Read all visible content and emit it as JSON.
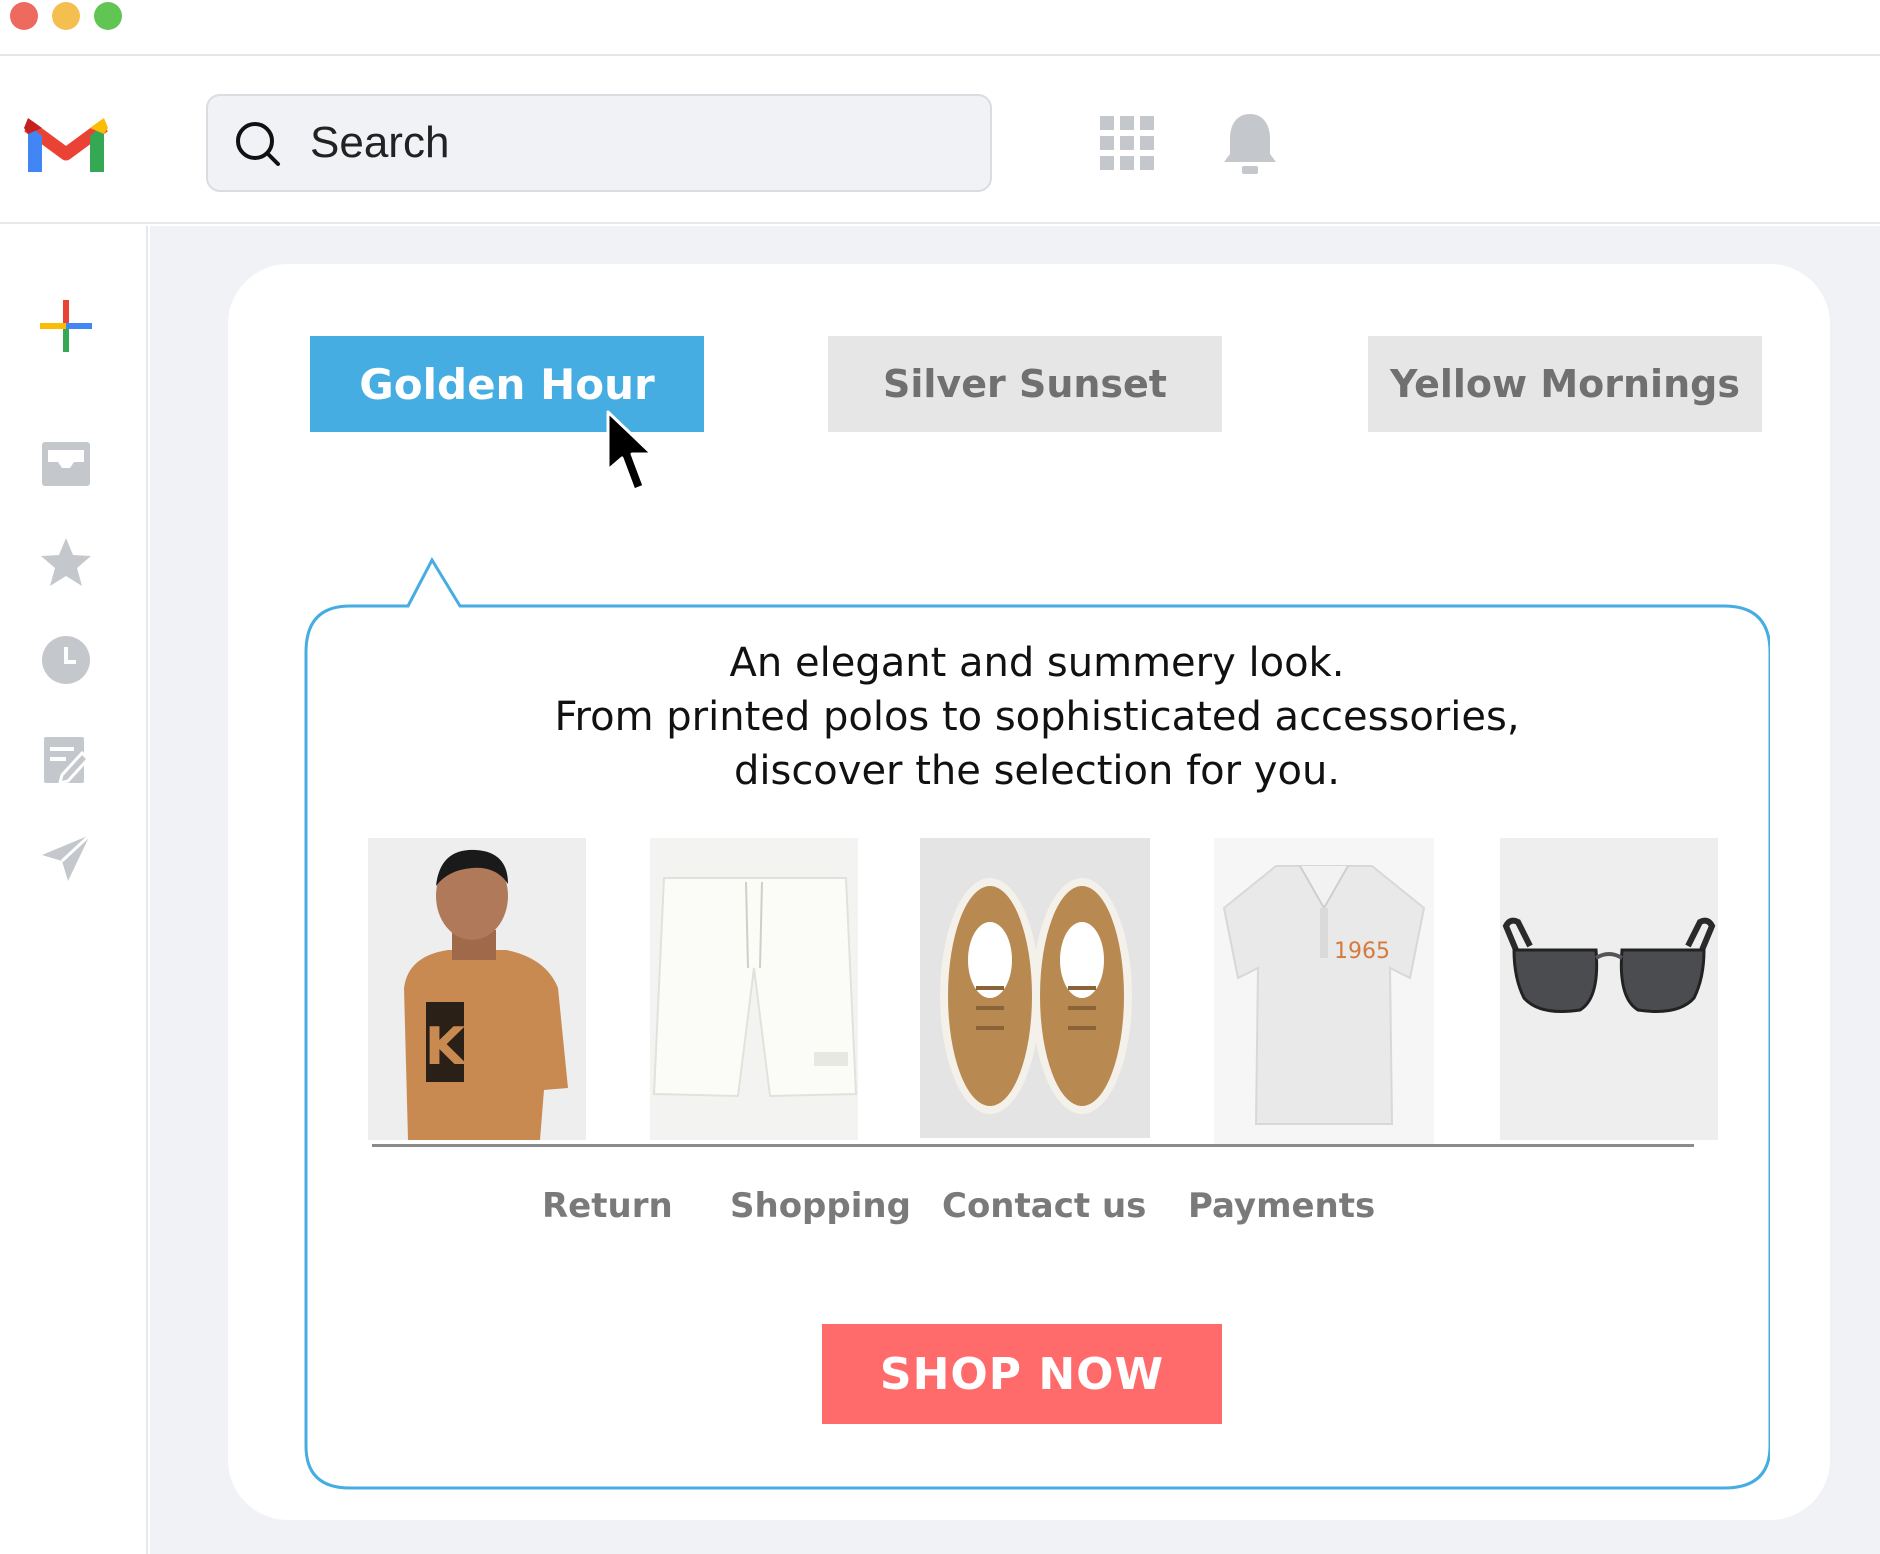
{
  "window": {
    "controls": [
      "close",
      "minimize",
      "zoom"
    ],
    "control_colors": [
      "#ec6a5e",
      "#f4bf4f",
      "#61c554"
    ]
  },
  "header": {
    "logo_icon": "gmail-logo",
    "search_placeholder": "Search",
    "apps_icon": "apps-grid-icon",
    "notifications_icon": "bell-icon"
  },
  "sidebar": {
    "items": [
      {
        "icon": "compose-plus-icon"
      },
      {
        "icon": "inbox-icon"
      },
      {
        "icon": "star-icon"
      },
      {
        "icon": "clock-icon"
      },
      {
        "icon": "drafts-icon"
      },
      {
        "icon": "send-icon"
      }
    ]
  },
  "tabs": [
    {
      "label": "Golden Hour",
      "active": true
    },
    {
      "label": "Silver Sunset",
      "active": false
    },
    {
      "label": "Yellow Mornings",
      "active": false
    }
  ],
  "message": {
    "line1": "An elegant and summery look.",
    "line2": "From printed polos to sophisticated accessories,",
    "line3": "discover the selection for you."
  },
  "products": [
    {
      "name": "printed-tshirt",
      "print_text": "K"
    },
    {
      "name": "white-shorts"
    },
    {
      "name": "tan-sneakers"
    },
    {
      "name": "white-polo",
      "print_text": "1965"
    },
    {
      "name": "sunglasses"
    }
  ],
  "footer_links": [
    "Return",
    "Shopping",
    "Contact us",
    "Payments"
  ],
  "cta": {
    "label": "SHOP NOW"
  },
  "colors": {
    "accent": "#45ade1",
    "cta": "#ff6b6b",
    "inactive_tab_bg": "#e6e6e6",
    "panel_border": "#45ade1",
    "background": "#f0f2f5"
  }
}
